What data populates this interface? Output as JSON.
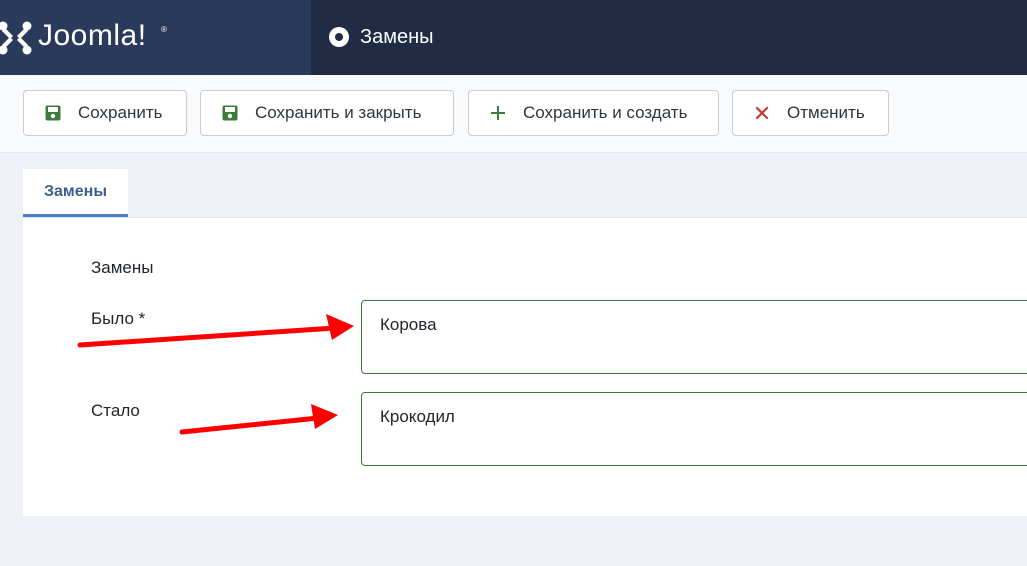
{
  "header": {
    "logo_text": "Joomla!",
    "logo_reg": "®",
    "page_title": "Замены"
  },
  "toolbar": {
    "save_label": "Сохранить",
    "save_close_label": "Сохранить и закрыть",
    "save_new_label": "Сохранить и создать",
    "cancel_label": "Отменить"
  },
  "tabs": [
    {
      "label": "Замены",
      "active": true
    }
  ],
  "form": {
    "legend": "Замены",
    "fields": [
      {
        "label": "Было *",
        "value": "Корова"
      },
      {
        "label": "Стало",
        "value": "Крокодил"
      }
    ]
  },
  "colors": {
    "header_bg": "#1f2c44",
    "logo_bg": "#2a3a5a",
    "save_icon": "#3d7a3d",
    "cancel_icon": "#c0392b",
    "annotation_arrow": "#ff0000",
    "tab_accent": "#4f7ec2"
  },
  "icons": {
    "save": "floppy-disk-icon",
    "save_new": "plus-icon",
    "cancel": "close-icon",
    "title": "radio-dot-icon"
  }
}
